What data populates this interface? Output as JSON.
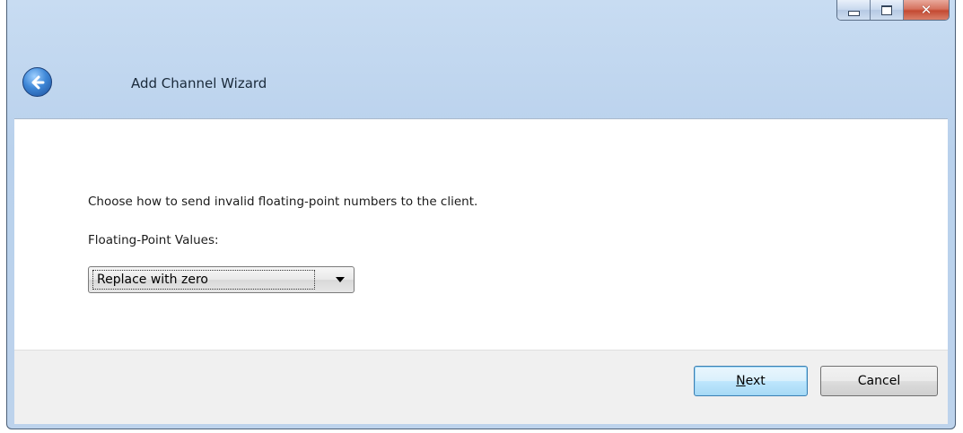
{
  "window": {
    "title": "Add Channel Wizard",
    "caption_buttons": [
      "minimize",
      "maximize",
      "close"
    ]
  },
  "nav": {
    "back_icon": "back-arrow-icon"
  },
  "content": {
    "instruction": "Choose how to send invalid floating-point numbers to the client.",
    "field_label": "Floating-Point Values:",
    "select": {
      "selected": "Replace with zero"
    }
  },
  "footer": {
    "next_mnemonic": "N",
    "next_rest": "ext",
    "cancel_label": "Cancel"
  },
  "colors": {
    "accent": "#3c7fb1",
    "titlebar": "#bdd3ec",
    "close_button": "#c44a32"
  }
}
